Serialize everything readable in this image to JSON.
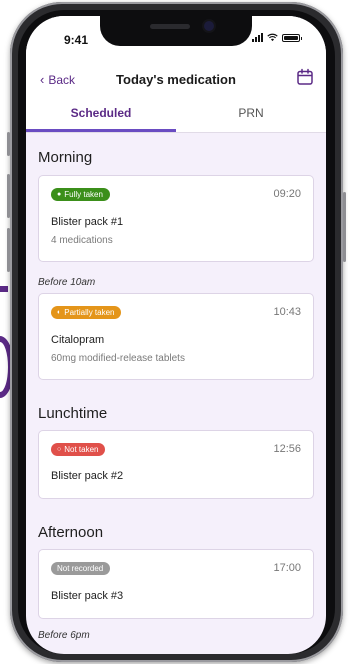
{
  "status_bar": {
    "time": "9:41"
  },
  "header": {
    "back_label": "Back",
    "title": "Today's medication",
    "calendar_icon": "calendar-icon"
  },
  "tabs": [
    {
      "label": "Scheduled",
      "active": true
    },
    {
      "label": "PRN",
      "active": false
    }
  ],
  "sections": {
    "morning": {
      "title": "Morning"
    },
    "lunchtime": {
      "title": "Lunchtime"
    },
    "afternoon": {
      "title": "Afternoon"
    }
  },
  "before_labels": {
    "before_10am": "Before 10am",
    "before_6pm": "Before 6pm"
  },
  "cards": [
    {
      "status": "Fully taken",
      "status_color": "#3b8f1a",
      "time": "09:20",
      "title": "Blister pack #1",
      "subtitle": "4 medications"
    },
    {
      "status": "Partially taken",
      "status_color": "#e4951a",
      "time": "10:43",
      "title": "Citalopram",
      "subtitle": "60mg modified-release tablets"
    },
    {
      "status": "Not taken",
      "status_color": "#e0504a",
      "time": "12:56",
      "title": "Blister pack #2"
    },
    {
      "status": "Not recorded",
      "status_color": "#9a9a9a",
      "time": "17:00",
      "title": "Blister pack #3"
    }
  ],
  "colors": {
    "accent": "#5b2a86",
    "tab_underline": "#6a4cc2",
    "screen_bg": "#f5f0fb"
  }
}
